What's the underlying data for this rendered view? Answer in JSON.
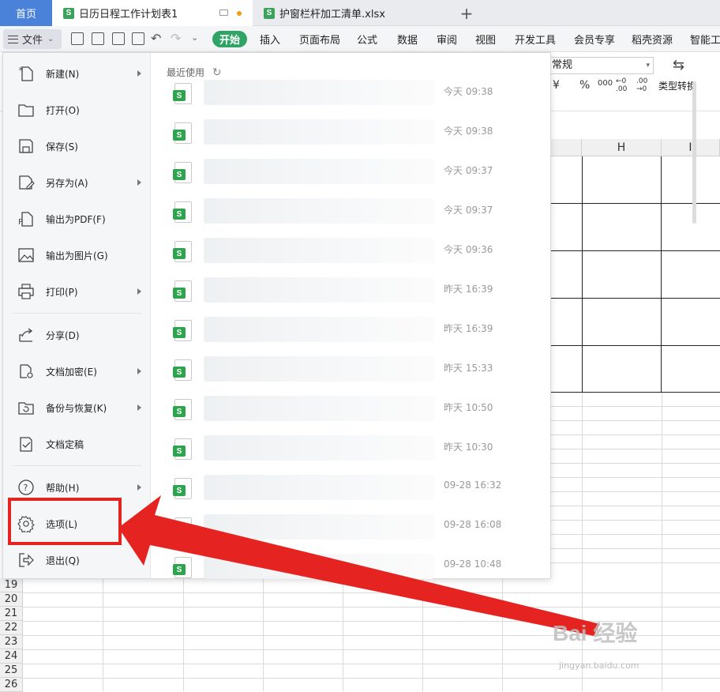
{
  "tabs": {
    "home": "首页",
    "doc1": "日历日程工作计划表1",
    "doc2": "护窗栏杆加工清单.xlsx",
    "add": "+"
  },
  "toolbar": {
    "file": "文件",
    "menus": [
      "开始",
      "插入",
      "页面布局",
      "公式",
      "数据",
      "审阅",
      "视图",
      "开发工具",
      "会员专享",
      "稻壳资源",
      "智能工"
    ]
  },
  "ribbon": {
    "number_format": "常规",
    "type_convert": "类型转换",
    "symbols": [
      "¥",
      "%",
      "000",
      "←0 .00",
      ".00 →0"
    ]
  },
  "columns": [
    "H",
    "I"
  ],
  "rows": [
    "19",
    "20",
    "21",
    "22",
    "23",
    "24",
    "25",
    "26"
  ],
  "file_menu": {
    "items": [
      {
        "label": "新建(N)",
        "icon": "new-file-icon",
        "arrow": true
      },
      {
        "label": "打开(O)",
        "icon": "folder-open-icon",
        "arrow": false
      },
      {
        "label": "保存(S)",
        "icon": "save-icon",
        "arrow": false
      },
      {
        "label": "另存为(A)",
        "icon": "save-as-icon",
        "arrow": true
      },
      {
        "label": "输出为PDF(F)",
        "icon": "pdf-export-icon",
        "arrow": false
      },
      {
        "label": "输出为图片(G)",
        "icon": "image-export-icon",
        "arrow": false
      },
      {
        "label": "打印(P)",
        "icon": "printer-icon",
        "arrow": true
      },
      {
        "label": "分享(D)",
        "icon": "share-icon",
        "arrow": false
      },
      {
        "label": "文档加密(E)",
        "icon": "encrypt-icon",
        "arrow": true
      },
      {
        "label": "备份与恢复(K)",
        "icon": "backup-icon",
        "arrow": true
      },
      {
        "label": "文档定稿",
        "icon": "finalize-icon",
        "arrow": false
      },
      {
        "label": "帮助(H)",
        "icon": "help-icon",
        "arrow": true
      },
      {
        "label": "选项(L)",
        "icon": "gear-icon",
        "arrow": false
      },
      {
        "label": "退出(Q)",
        "icon": "exit-icon",
        "arrow": false
      }
    ],
    "recent_title": "最近使用",
    "recent_files": [
      {
        "time": "今天  09:38"
      },
      {
        "time": "今天  09:38"
      },
      {
        "time": "今天  09:37"
      },
      {
        "time": "今天  09:37"
      },
      {
        "time": "今天  09:36"
      },
      {
        "time": "昨天  16:39"
      },
      {
        "time": "昨天  16:39"
      },
      {
        "time": "昨天  15:33"
      },
      {
        "time": "昨天  10:50"
      },
      {
        "time": "昨天  10:30"
      },
      {
        "time": "09-28 16:32"
      },
      {
        "time": "09-28 16:08"
      },
      {
        "time": "09-28 10:48"
      }
    ]
  },
  "watermark": {
    "brand": "Bai 经验",
    "url": "jingyan.baidu.com"
  },
  "colors": {
    "highlight": "#e52421",
    "accent_green": "#2fa465",
    "home_tab": "#4a82d9"
  }
}
